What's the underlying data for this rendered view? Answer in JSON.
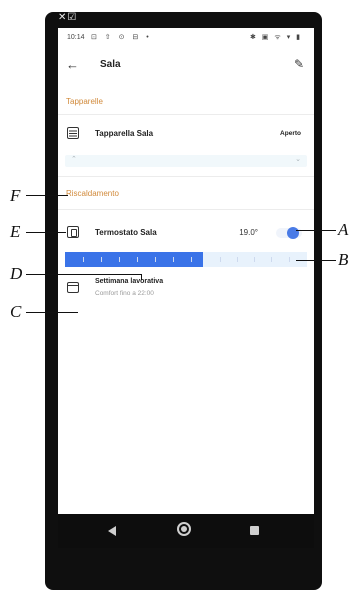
{
  "device": {
    "status_time": "10:14",
    "status_icons_left": "⊡ ⇧ ⊙ ⊟ •",
    "status_icons_right": "✱ ▣ ᯤ ▾ ▮",
    "top_glyph": "✕☑"
  },
  "appbar": {
    "title": "Sala",
    "back_icon": "arrow-left-icon",
    "edit_icon": "pencil-icon"
  },
  "sections": [
    {
      "title": "Tapparelle",
      "device": {
        "name": "Tapparella Sala",
        "state": "Aperto",
        "icon": "shutter-icon"
      }
    },
    {
      "title": "Riscaldamento",
      "device": {
        "name": "Termostato Sala",
        "temperature": "19.0°",
        "icon": "thermostat-icon",
        "toggle_on": true,
        "setpoint_fraction": 0.57
      },
      "schedule": {
        "title": "Settimana lavorativa",
        "subtitle": "Comfort fino a 22:00",
        "icon": "calendar-icon"
      }
    }
  ],
  "callouts": {
    "A": "A",
    "B": "B",
    "C": "C",
    "D": "D",
    "E": "E",
    "F": "F"
  },
  "colors": {
    "accent": "#d18a3b",
    "blue": "#3a73e8",
    "pill_bg": "#f1f8fb"
  }
}
